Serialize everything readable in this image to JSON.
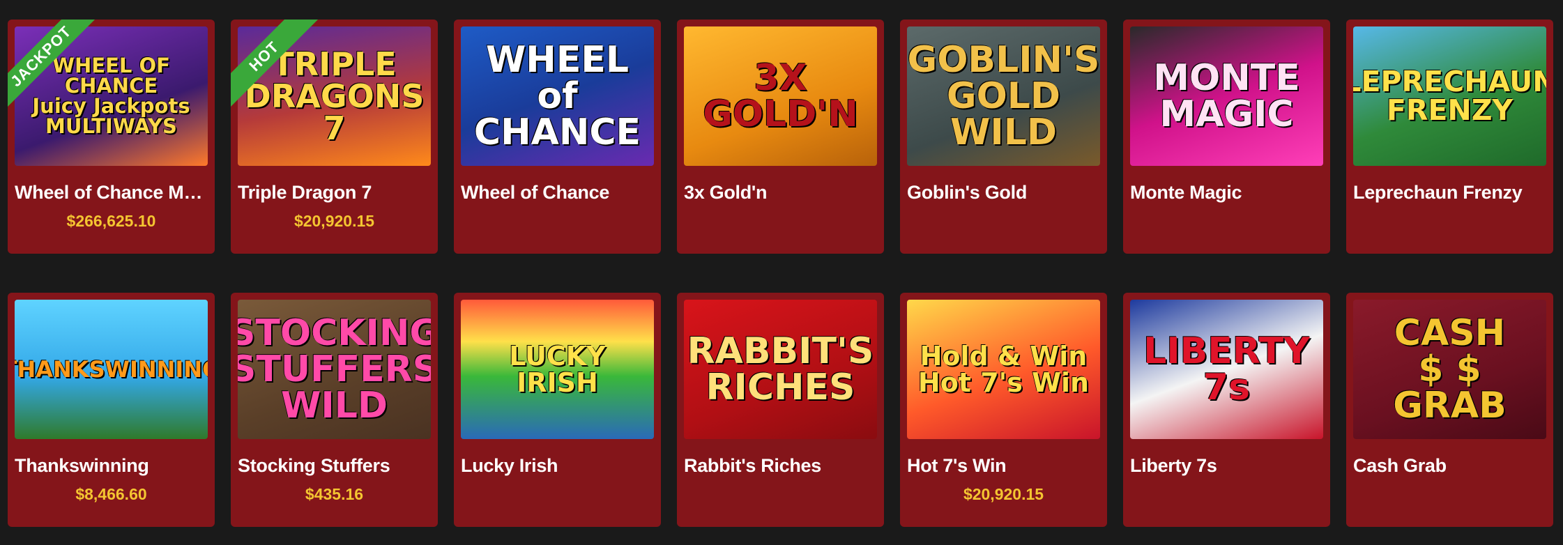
{
  "games": [
    {
      "title": "Wheel of Chance Multi…",
      "jackpot": "$266,625.10",
      "ribbon": "JACKPOT",
      "art": "WHEEL OF\nCHANCE\nJuicy Jackpots\nMULTIWAYS",
      "art_color": "#ffd94a",
      "bg": "linear-gradient(160deg,#7b2fb8,#3b1a6e 60%,#ff7a2a)"
    },
    {
      "title": "Triple Dragon 7",
      "jackpot": "$20,920.15",
      "ribbon": "HOT",
      "art": "TRIPLE\nDRAGONS 7",
      "art_color": "#ffd94a",
      "bg": "linear-gradient(170deg,#5a2a9a,#b53a3a 55%,#ff8a1a)"
    },
    {
      "title": "Wheel of Chance",
      "jackpot": "",
      "ribbon": "",
      "art": "WHEEL\nof\nCHANCE",
      "art_color": "#ffffff",
      "bg": "linear-gradient(160deg,#1e5bc6,#1a3c9a 50%,#6a2ab0)"
    },
    {
      "title": "3x Gold'n",
      "jackpot": "",
      "ribbon": "",
      "art": "3X\nGOLD'N",
      "art_color": "#b5121b",
      "bg": "linear-gradient(160deg,#ffb830,#e88a10 60%,#b8620a)"
    },
    {
      "title": "Goblin's Gold",
      "jackpot": "",
      "ribbon": "",
      "art": "GOBLIN'S\nGOLD\nWILD",
      "art_color": "#f2c14a",
      "bg": "linear-gradient(160deg,#5c6a6a,#3d4a4a 60%,#7a5a2a)"
    },
    {
      "title": "Monte Magic",
      "jackpot": "",
      "ribbon": "",
      "art": "MONTE\nMAGIC",
      "art_color": "#ffe3f4",
      "bg": "linear-gradient(160deg,#2a2a2a,#d0128a 50%,#ff3fb8)"
    },
    {
      "title": "Leprechaun Frenzy",
      "jackpot": "",
      "ribbon": "",
      "art": "LEPRECHAUN\nFRENZY",
      "art_color": "#ffe14a",
      "bg": "linear-gradient(160deg,#57b8e8,#2f8a3a 55%,#1f6a2a)"
    },
    {
      "title": "Thankswinning",
      "jackpot": "$8,466.60",
      "ribbon": "",
      "art": "THANKSWINNING",
      "art_color": "#ff9a1a",
      "bg": "linear-gradient(180deg,#5fd3ff,#33a8e8 55%,#2f7a2a)"
    },
    {
      "title": "Stocking Stuffers",
      "jackpot": "$435.16",
      "ribbon": "",
      "art": "STOCKING\nSTUFFERS\nWILD",
      "art_color": "#ff4aa8",
      "bg": "linear-gradient(160deg,#7a5a3a,#5a3f28 60%,#4a3222)"
    },
    {
      "title": "Lucky Irish",
      "jackpot": "",
      "ribbon": "",
      "art": "LUCKY IRISH",
      "art_color": "#ffe14a",
      "bg": "linear-gradient(180deg,#ff5a3a,#ffe04a 30%,#3ab83a 55%,#2a6ab8)"
    },
    {
      "title": "Rabbit's Riches",
      "jackpot": "",
      "ribbon": "",
      "art": "RABBIT'S\nRICHES",
      "art_color": "#ffe07a",
      "bg": "linear-gradient(160deg,#d8141a,#b10f14 60%,#8a0c10)"
    },
    {
      "title": "Hot 7's Win",
      "jackpot": "$20,920.15",
      "ribbon": "",
      "art": "Hold & Win\nHot 7's Win",
      "art_color": "#ffe04a",
      "bg": "linear-gradient(160deg,#ffd84a,#ff5a2a 55%,#c8142a)"
    },
    {
      "title": "Liberty 7s",
      "jackpot": "",
      "ribbon": "",
      "art": "LIBERTY\n7s",
      "art_color": "#e0142a",
      "bg": "linear-gradient(160deg,#1d3a9e,#f4f4f4 50%,#c8142a)"
    },
    {
      "title": "Cash Grab",
      "jackpot": "",
      "ribbon": "",
      "art": "CASH\n$ $\nGRAB",
      "art_color": "#f4c531",
      "bg": "linear-gradient(160deg,#8a1a2a,#6a1020 60%,#4a0a16)"
    }
  ]
}
